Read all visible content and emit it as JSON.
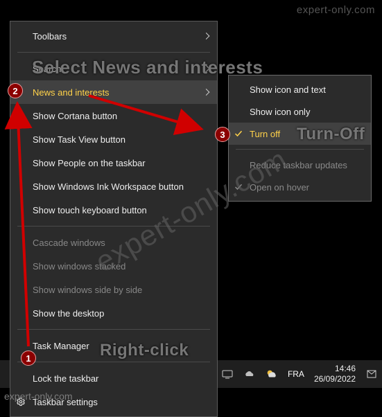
{
  "watermark": {
    "top_right": "expert-only.com",
    "diagonal": "expert-only.com",
    "bottom_left": "expert-only.com"
  },
  "context_menu": {
    "items": [
      {
        "label": "Toolbars"
      },
      {
        "label": "Search"
      },
      {
        "label": "News and interests"
      },
      {
        "label": "Show Cortana button"
      },
      {
        "label": "Show Task View button"
      },
      {
        "label": "Show People on the taskbar"
      },
      {
        "label": "Show Windows Ink Workspace button"
      },
      {
        "label": "Show touch keyboard button"
      },
      {
        "label": "Cascade windows"
      },
      {
        "label": "Show windows stacked"
      },
      {
        "label": "Show windows side by side"
      },
      {
        "label": "Show the desktop"
      },
      {
        "label": "Task Manager"
      },
      {
        "label": "Lock the taskbar"
      },
      {
        "label": "Taskbar settings"
      }
    ]
  },
  "submenu": {
    "items": [
      {
        "label": "Show icon and text"
      },
      {
        "label": "Show icon only"
      },
      {
        "label": "Turn off"
      },
      {
        "label": "Reduce taskbar updates"
      },
      {
        "label": "Open on hover"
      }
    ]
  },
  "taskbar": {
    "language": "FRA",
    "time": "14:46",
    "date": "26/09/2022"
  },
  "annotations": {
    "title": "Select News and interests",
    "right_click": "Right-click",
    "turn_off": "Turn-Off",
    "badge1": "1",
    "badge2": "2",
    "badge3": "3"
  }
}
